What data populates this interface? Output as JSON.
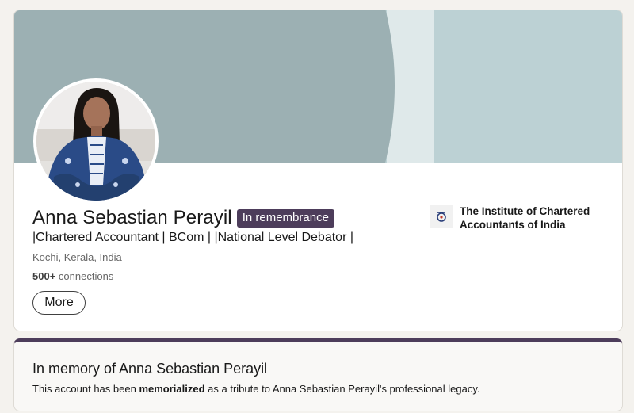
{
  "profile": {
    "name": "Anna Sebastian Perayil",
    "badge": "In remembrance",
    "headline": "|Chartered Accountant | BCom | |National Level Debator |",
    "location": "Kochi, Kerala, India",
    "connections_count": "500+",
    "connections_label": "connections",
    "more_label": "More"
  },
  "organization": {
    "name": "The Institute of Chartered Accountants of India",
    "logo_icon": "icai-logo-icon"
  },
  "memorial": {
    "title": "In memory of Anna Sebastian Perayil",
    "text_before": "This account has been",
    "text_bold": "memorialized",
    "text_after": "as a tribute to Anna Sebastian Perayil's professional legacy."
  },
  "colors": {
    "badge_bg": "#4d3d5b",
    "banner_light": "#bcd1d4",
    "banner_dark": "#9cb0b3"
  }
}
